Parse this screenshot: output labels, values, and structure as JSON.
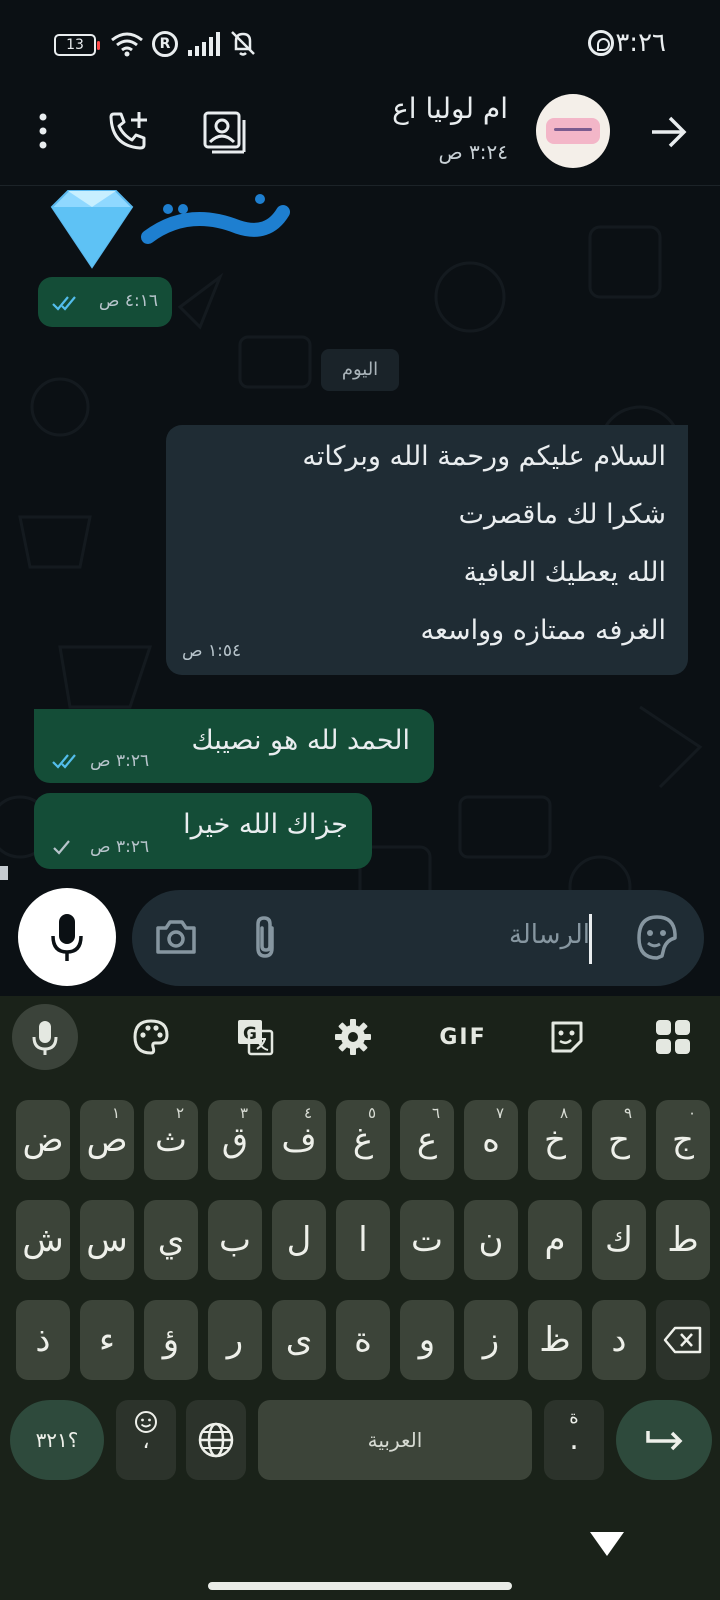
{
  "status_bar": {
    "time": "٣:٢٦",
    "battery": "13",
    "roaming": "R"
  },
  "header": {
    "contact_name": "ام لوليا اع",
    "last_seen": "٣:٢٤ ص"
  },
  "chat": {
    "sticker_meta": {
      "time": "٤:١٦ ص",
      "status": "read"
    },
    "date_divider": "اليوم",
    "incoming": {
      "lines": [
        "السلام عليكم ورحمة الله وبركاته",
        "شكرا لك ماقصرت",
        "الله يعطيك العافية",
        "الغرفه ممتازه وواسعه"
      ],
      "time": "١:٥٤ ص"
    },
    "outgoing": [
      {
        "text": "الحمد لله هو نصيبك",
        "time": "٣:٢٦ ص",
        "status": "read"
      },
      {
        "text": "جزاك الله خيرا",
        "time": "٣:٢٦ ص",
        "status": "sent"
      }
    ]
  },
  "composer": {
    "placeholder": "الرسالة"
  },
  "keyboard": {
    "toolbar": {
      "gif_label": "GIF"
    },
    "row1": [
      {
        "char": "ج",
        "hint": "٠"
      },
      {
        "char": "ح",
        "hint": "٩"
      },
      {
        "char": "خ",
        "hint": "٨"
      },
      {
        "char": "ه",
        "hint": "٧"
      },
      {
        "char": "ع",
        "hint": "٦"
      },
      {
        "char": "غ",
        "hint": "٥"
      },
      {
        "char": "ف",
        "hint": "٤"
      },
      {
        "char": "ق",
        "hint": "٣"
      },
      {
        "char": "ث",
        "hint": "٢"
      },
      {
        "char": "ص",
        "hint": "١"
      },
      {
        "char": "ض",
        "hint": ""
      }
    ],
    "row2": [
      "ط",
      "ك",
      "م",
      "ن",
      "ت",
      "ا",
      "ل",
      "ب",
      "ي",
      "س",
      "ش"
    ],
    "row3": [
      "د",
      "ظ",
      "ز",
      "و",
      "ة",
      "ى",
      "ر",
      "ؤ",
      "ء",
      "ذ"
    ],
    "symbols_label": "؟٣٢١",
    "comma_label": "،",
    "space_label": "العربية",
    "period_label": ".",
    "period_hint": "ة"
  },
  "colors": {
    "outgoing_bubble": "#144d37",
    "incoming_bubble": "#1f2c34",
    "read_ticks": "#53bdeb",
    "background": "#0b1014",
    "keyboard_bg": "#1a2219"
  }
}
